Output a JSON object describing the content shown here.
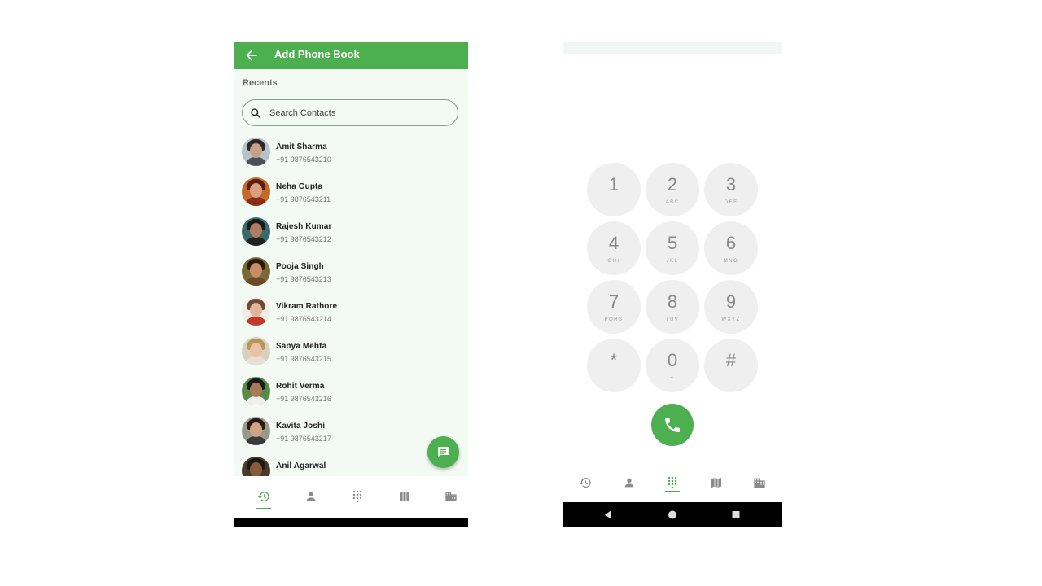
{
  "colors": {
    "accent": "#4caf50",
    "key_bg": "#efefef",
    "screen_bg": "#f3faf3"
  },
  "left_screen": {
    "appbar": {
      "title": "Add Phone Book",
      "back_icon": "arrow-back-icon"
    },
    "section_label": "Recents",
    "search": {
      "placeholder": "Search Contacts",
      "value": "",
      "icon": "search-icon"
    },
    "contacts": [
      {
        "name": "Amit Sharma",
        "phone": "+91 9876543210",
        "avatar_skin": "#c9a086",
        "avatar_hair": "#2a2a2a",
        "avatar_bg": "#b8c2cc",
        "avatar_shirt": "#4a4f5c"
      },
      {
        "name": "Neha Gupta",
        "phone": "+91 9876543211",
        "avatar_skin": "#d8a07e",
        "avatar_hair": "#5a1f12",
        "avatar_bg": "#c46a2c",
        "avatar_shirt": "#8a2a1a"
      },
      {
        "name": "Rajesh Kumar",
        "phone": "+91 9876543212",
        "avatar_skin": "#b07c5e",
        "avatar_hair": "#1a1a1a",
        "avatar_bg": "#3a6a6a",
        "avatar_shirt": "#222222"
      },
      {
        "name": "Pooja Singh",
        "phone": "+91 9876543213",
        "avatar_skin": "#c98d6a",
        "avatar_hair": "#2a1a10",
        "avatar_bg": "#7a6a3a",
        "avatar_shirt": "#6a4a2a"
      },
      {
        "name": "Vikram Rathore",
        "phone": "+91 9876543214",
        "avatar_skin": "#e2b49a",
        "avatar_hair": "#6a4a30",
        "avatar_bg": "#f2ece8",
        "avatar_shirt": "#c0392b"
      },
      {
        "name": "Sanya Mehta",
        "phone": "+91 9876543215",
        "avatar_skin": "#e6c2a2",
        "avatar_hair": "#b8945a",
        "avatar_bg": "#d8d0c0",
        "avatar_shirt": "#e8e0d8"
      },
      {
        "name": "Rohit Verma",
        "phone": "+91 9876543216",
        "avatar_skin": "#a87a58",
        "avatar_hair": "#1a1a1a",
        "avatar_bg": "#5a8a4a",
        "avatar_shirt": "#f0f0f0"
      },
      {
        "name": "Kavita Joshi",
        "phone": "+91 9876543217",
        "avatar_skin": "#d2a286",
        "avatar_hair": "#2a1a14",
        "avatar_bg": "#9a9a8a",
        "avatar_shirt": "#3a3a3a"
      },
      {
        "name": "Anil Agarwal",
        "phone": "",
        "avatar_skin": "#8a5a3a",
        "avatar_hair": "#1a1a1a",
        "avatar_bg": "#4a3a2a",
        "avatar_shirt": "#2a2a2a"
      }
    ],
    "fab_icon": "message-icon",
    "bottom_nav": [
      {
        "icon": "history-icon",
        "active": true
      },
      {
        "icon": "person-icon",
        "active": false
      },
      {
        "icon": "dialpad-icon",
        "active": false
      },
      {
        "icon": "map-icon",
        "active": false
      },
      {
        "icon": "building-icon",
        "active": false
      }
    ]
  },
  "right_screen": {
    "keypad": [
      {
        "digit": "1",
        "letters": ""
      },
      {
        "digit": "2",
        "letters": "ABC"
      },
      {
        "digit": "3",
        "letters": "DEF"
      },
      {
        "digit": "4",
        "letters": "GHI"
      },
      {
        "digit": "5",
        "letters": "JKL"
      },
      {
        "digit": "6",
        "letters": "MNO"
      },
      {
        "digit": "7",
        "letters": "PQRS"
      },
      {
        "digit": "8",
        "letters": "TUV"
      },
      {
        "digit": "9",
        "letters": "WXYZ"
      },
      {
        "digit": "*",
        "letters": ""
      },
      {
        "digit": "0",
        "letters": "+"
      },
      {
        "digit": "#",
        "letters": ""
      }
    ],
    "call_icon": "phone-icon",
    "bottom_nav": [
      {
        "icon": "history-icon",
        "active": false
      },
      {
        "icon": "person-icon",
        "active": false
      },
      {
        "icon": "dialpad-icon",
        "active": true
      },
      {
        "icon": "map-icon",
        "active": false
      },
      {
        "icon": "building-icon",
        "active": false
      }
    ],
    "system_nav": [
      "back-triangle-icon",
      "home-circle-icon",
      "recents-square-icon"
    ]
  }
}
